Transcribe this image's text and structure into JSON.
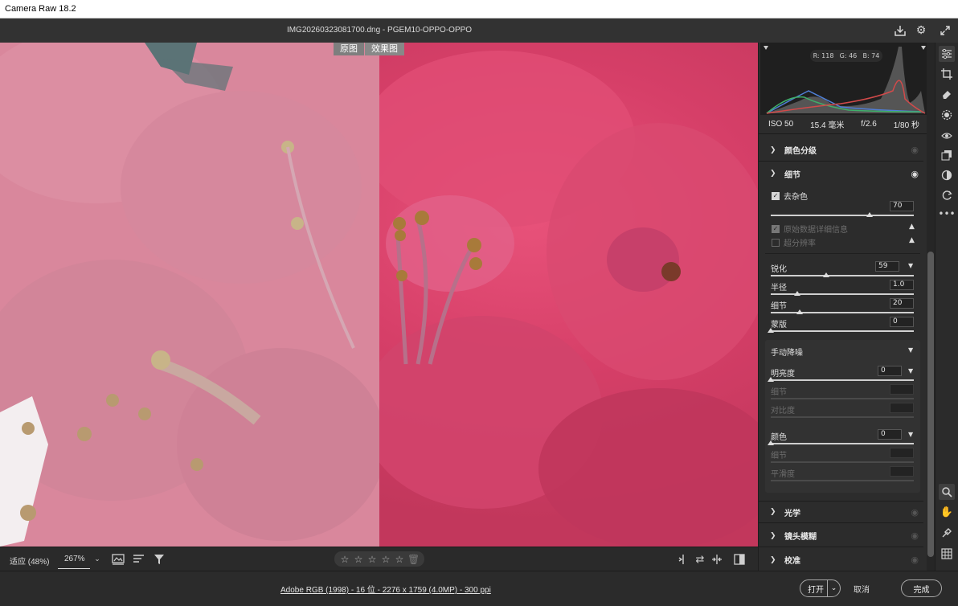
{
  "window": {
    "title": "Camera Raw 18.2"
  },
  "header": {
    "filename": "IMG20260323081700.dng -  PGEM10-OPPO-OPPO"
  },
  "compare": {
    "before_label": "原图",
    "after_label": "效果图"
  },
  "bottom_toolbar": {
    "fit_label": "适应 (48%)",
    "zoom_value": "267%",
    "stars": [
      "☆",
      "☆",
      "☆",
      "☆",
      "☆"
    ]
  },
  "histogram": {
    "r": "R: 118",
    "g": "G: 46",
    "b": "B: 74"
  },
  "exif": {
    "iso": "ISO 50",
    "focal": "15.4 毫米",
    "aperture": "f/2.6",
    "shutter": "1/80 秒"
  },
  "sections": {
    "color_grading": "颜色分级",
    "detail": "细节",
    "optics": "光学",
    "lens_blur": "镜头模糊",
    "calibration": "校准"
  },
  "detail": {
    "denoise_label": "去杂色",
    "denoise_value": "70",
    "raw_details_label": "原始数据详细信息",
    "super_res_label": "超分辨率",
    "sharpening": {
      "label": "锐化",
      "value": "59"
    },
    "radius": {
      "label": "半径",
      "value": "1.0"
    },
    "detail": {
      "label": "细节",
      "value": "20"
    },
    "masking": {
      "label": "蒙版",
      "value": "0"
    },
    "manual_nr": "手动降噪",
    "luminance": {
      "label": "明亮度",
      "value": "0"
    },
    "lum_detail": {
      "label": "细节"
    },
    "lum_contrast": {
      "label": "对比度"
    },
    "color": {
      "label": "颜色",
      "value": "0"
    },
    "color_detail": {
      "label": "细节"
    },
    "color_smooth": {
      "label": "平滑度"
    }
  },
  "status": {
    "file_info": "Adobe RGB (1998) - 16 位 - 2276 x 1759 (4.0MP) - 300 ppi",
    "open_label": "打开",
    "cancel_label": "取消",
    "done_label": "完成"
  }
}
